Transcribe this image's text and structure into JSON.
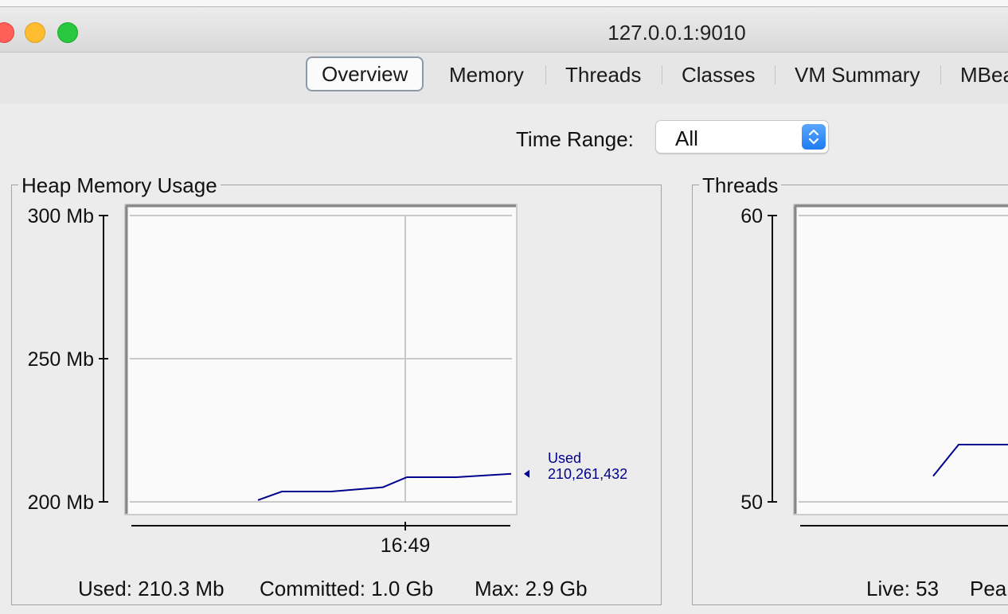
{
  "window": {
    "title": "127.0.0.1:9010"
  },
  "tabs": [
    {
      "label": "Overview",
      "active": true
    },
    {
      "label": "Memory"
    },
    {
      "label": "Threads"
    },
    {
      "label": "Classes"
    },
    {
      "label": "VM Summary"
    },
    {
      "label": "MBea"
    }
  ],
  "time_range": {
    "label": "Time Range:",
    "value": "All"
  },
  "heap_panel": {
    "title": "Heap Memory Usage",
    "used": "Used: 210.3 Mb",
    "committed": "Committed: 1.0 Gb",
    "max": "Max: 2.9 Gb",
    "marker_name": "Used",
    "marker_value": "210,261,432"
  },
  "threads_panel": {
    "title": "Threads",
    "live": "Live: 53",
    "peak": "Peak"
  },
  "colors": {
    "series": "#00008c",
    "accent": "#2a84f6"
  },
  "chart_data": [
    {
      "type": "line",
      "title": "Heap Memory Usage",
      "ylim": [
        200,
        300
      ],
      "yticks": [
        "200 Mb",
        "250 Mb",
        "300 Mb"
      ],
      "ytick_values": [
        200,
        250,
        300
      ],
      "xticks": [
        "16:49"
      ],
      "grid": true,
      "series": [
        {
          "name": "Used",
          "values": [
            200.6,
            203.6,
            203.6,
            205.1,
            208.6,
            208.6,
            209.8
          ]
        }
      ]
    },
    {
      "type": "line",
      "title": "Threads",
      "ylim": [
        50,
        60
      ],
      "yticks": [
        "50",
        "60"
      ],
      "ytick_values": [
        50,
        60
      ],
      "grid": true,
      "series": [
        {
          "values": [
            50.9,
            52.0,
            52.0
          ]
        }
      ]
    }
  ]
}
